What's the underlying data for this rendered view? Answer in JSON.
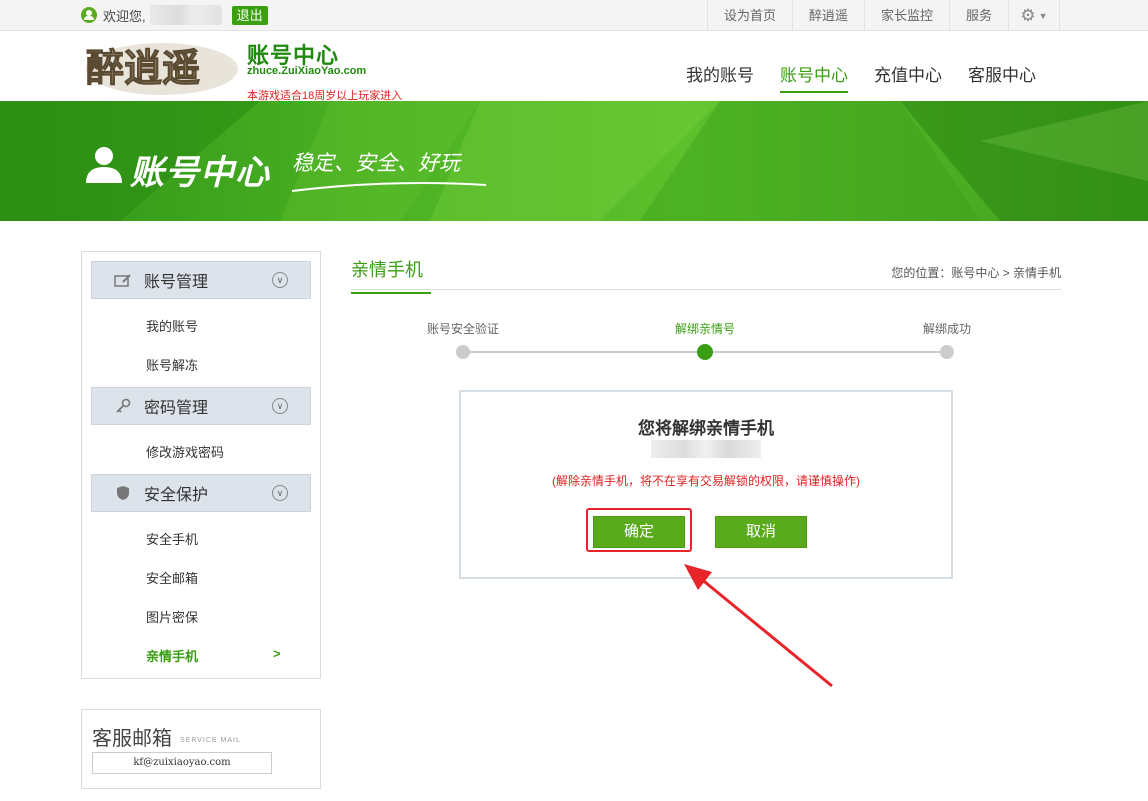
{
  "topbar": {
    "welcome": "欢迎您,",
    "logout": "退出",
    "links": [
      "设为首页",
      "醉逍遥",
      "家长监控",
      "服务"
    ]
  },
  "header": {
    "logo_text": "醉逍遥",
    "title": "账号中心",
    "url": "zhuce.ZuiXiaoYao.com",
    "age_notice": "本游戏适合18周岁以上玩家进入",
    "nav": [
      "我的账号",
      "账号中心",
      "充值中心",
      "客服中心"
    ],
    "active_nav": "账号中心"
  },
  "banner": {
    "title": "账号中心",
    "slogan": "稳定、安全、好玩"
  },
  "sidebar": {
    "groups": [
      {
        "label": "账号管理",
        "items": [
          "我的账号",
          "账号解冻"
        ]
      },
      {
        "label": "密码管理",
        "items": [
          "修改游戏密码"
        ]
      },
      {
        "label": "安全保护",
        "items": [
          "安全手机",
          "安全邮箱",
          "图片密保",
          "亲情手机"
        ]
      }
    ],
    "active_item": "亲情手机",
    "active_arrow": ">"
  },
  "mailbox": {
    "title": "客服邮箱",
    "subtitle": "SERVICE MAIL",
    "email": "kf@zuixiaoyao.com"
  },
  "content": {
    "title": "亲情手机",
    "breadcrumb": "您的位置：账号中心 > 亲情手机",
    "steps": [
      {
        "label": "账号安全验证",
        "active": false
      },
      {
        "label": "解绑亲情号",
        "active": true
      },
      {
        "label": "解绑成功",
        "active": false
      }
    ],
    "dialog": {
      "title": "您将解绑亲情手机",
      "warning": "(解除亲情手机，将不在享有交易解锁的权限，请谨慎操作)",
      "confirm": "确定",
      "cancel": "取消"
    }
  },
  "colors": {
    "accent": "#3a9e12",
    "warning": "#e02020",
    "annotation": "#e8242b"
  }
}
